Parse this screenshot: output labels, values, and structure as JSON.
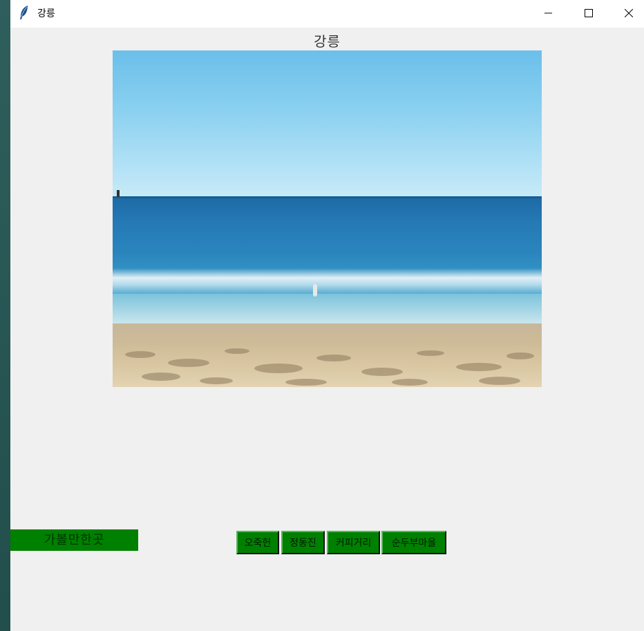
{
  "window": {
    "title": "강릉",
    "icon": "feather-icon",
    "controls": [
      "minimize-icon",
      "maximize-icon",
      "close-icon"
    ]
  },
  "heading": "강릉",
  "photo": {
    "subject": "beach-photo"
  },
  "side_label": "가볼만한곳",
  "buttons": [
    {
      "label": "오죽헌"
    },
    {
      "label": "정동진"
    },
    {
      "label": "커피거리"
    },
    {
      "label": "순두부마을"
    }
  ],
  "colors": {
    "button_bg": "#008000",
    "window_bg": "#f0f0f0",
    "titlebar_bg": "#ffffff"
  }
}
